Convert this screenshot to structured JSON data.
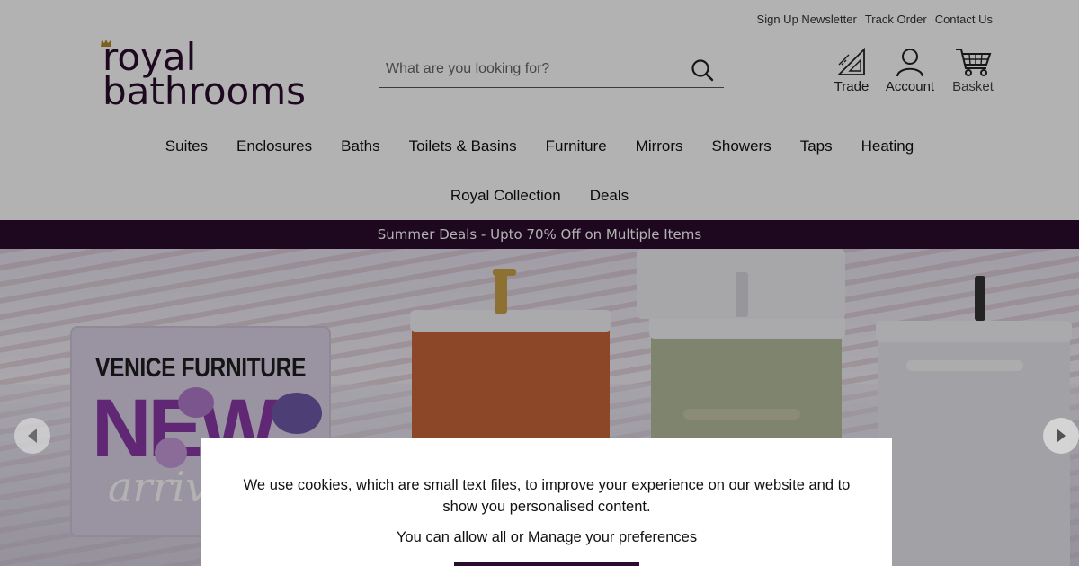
{
  "header": {
    "util_links": [
      "Sign Up Newsletter",
      "Track Order",
      "Contact Us"
    ],
    "logo": {
      "line1": "royal",
      "line2": "bathrooms"
    },
    "search": {
      "placeholder": "What are you looking for?",
      "value": ""
    },
    "icons": {
      "trade": {
        "label": "Trade",
        "icon": "set-square-ruler-icon"
      },
      "account": {
        "label": "Account",
        "icon": "user-icon"
      },
      "basket": {
        "label": "Basket",
        "icon": "cart-icon"
      }
    }
  },
  "nav": {
    "row1": [
      "Suites",
      "Enclosures",
      "Baths",
      "Toilets & Basins",
      "Furniture",
      "Mirrors",
      "Showers",
      "Taps",
      "Heating"
    ],
    "row2": [
      "Royal Collection",
      "Deals"
    ]
  },
  "promo": {
    "text": "Summer Deals - Upto 70% Off on Multiple Items"
  },
  "hero": {
    "sign_title": "VENICE FURNITURE",
    "sign_new": "NEW",
    "sign_arrival": "arrival"
  },
  "cookie": {
    "message": "We use cookies, which are small text files, to improve your experience on our website and to show you personalised content.",
    "message2": "You can allow all or Manage your preferences"
  },
  "colors": {
    "brand": "#2b0c2e",
    "accent_purple": "#8a3aa6",
    "unit_orange": "#c8663a",
    "unit_sage": "#b7bd9f",
    "unit_white": "#e9e9ee"
  }
}
